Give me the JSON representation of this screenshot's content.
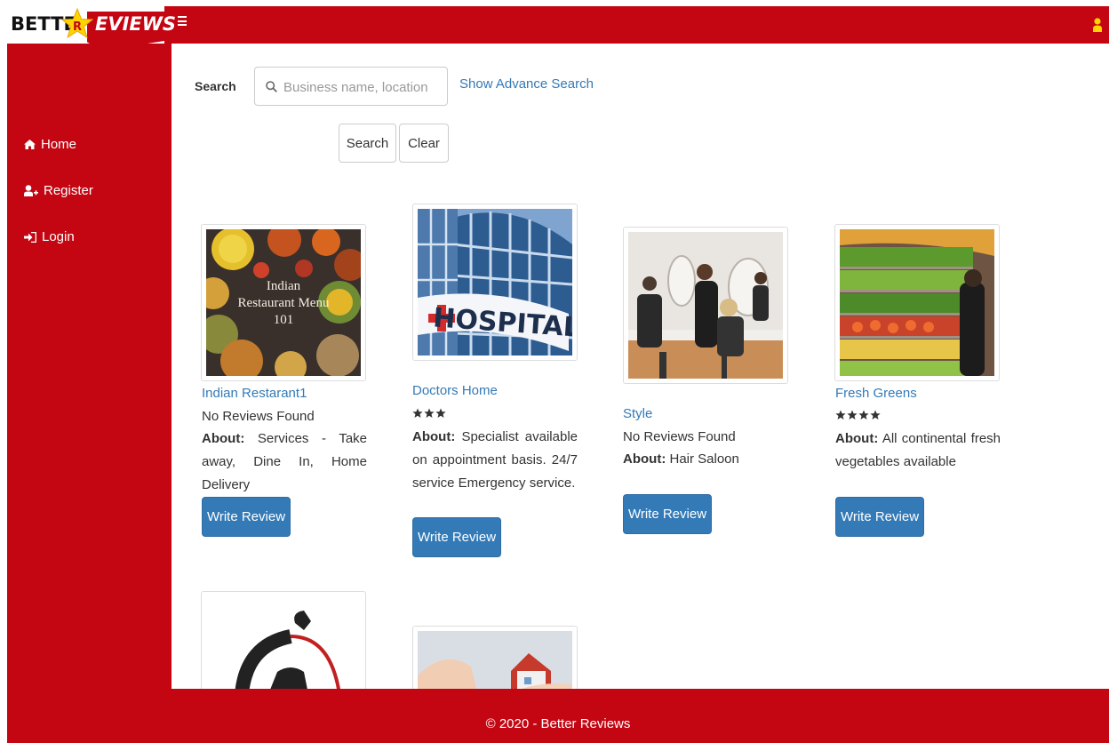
{
  "brand": {
    "logo_part1": "BETTE",
    "logo_mark": "R",
    "logo_part2": "EVIEWS",
    "primary_color": "#c30612",
    "link_color": "#337ab7"
  },
  "header": {
    "menu_icon": "hamburger-icon",
    "user_icon": "user-icon"
  },
  "sidebar": {
    "items": [
      {
        "label": "Home",
        "icon": "home-icon"
      },
      {
        "label": "Register",
        "icon": "user-plus-icon"
      },
      {
        "label": "Login",
        "icon": "sign-in-icon"
      }
    ]
  },
  "search": {
    "label": "Search",
    "placeholder": "Business name, location",
    "value": "",
    "advanced_link": "Show Advance Search",
    "search_button": "Search",
    "clear_button": "Clear"
  },
  "businesses": [
    {
      "name": "Indian Restarant1",
      "reviews_text": "No Reviews Found",
      "rating": 0,
      "about_label": "About:",
      "about": "Services - Take away, Dine In, Home Delivery",
      "image_text": [
        "Indian",
        "Restaurant Menu",
        "101"
      ],
      "button": "Write Review"
    },
    {
      "name": "Doctors Home",
      "reviews_text": "",
      "rating": 3,
      "about_label": "About:",
      "about": "Specialist available on appointment basis. 24/7 service Emergency service.",
      "image_text": [
        "HOSPITAL"
      ],
      "button": "Write Review"
    },
    {
      "name": "Style",
      "reviews_text": "No Reviews Found",
      "rating": 0,
      "about_label": "About:",
      "about": "Hair Saloon",
      "button": "Write Review"
    },
    {
      "name": "Fresh Greens",
      "reviews_text": "",
      "rating": 4,
      "about_label": "About:",
      "about": "All continental fresh vegetables available",
      "button": "Write Review"
    }
  ],
  "footer": {
    "text": "© 2020 - Better Reviews"
  }
}
